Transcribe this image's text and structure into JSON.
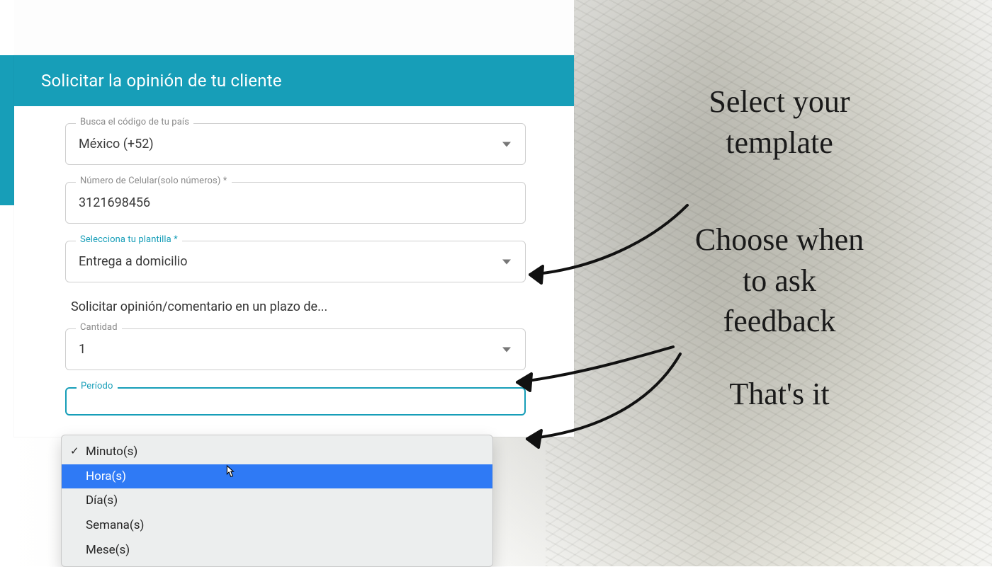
{
  "header": {
    "title": "Solicitar la opinión de tu cliente"
  },
  "fields": {
    "country": {
      "label": "Busca el código de tu país",
      "value": "México (+52)"
    },
    "phone": {
      "label": "Número de Celular(solo números) *",
      "value": "3121698456"
    },
    "template": {
      "label": "Selecciona tu plantilla *",
      "value": "Entrega a domicilio"
    },
    "schedule_section_label": "Solicitar opinión/comentario en un plazo de...",
    "quantity": {
      "label": "Cantidad",
      "value": "1"
    },
    "period": {
      "label": "Período",
      "options": [
        "Minuto(s)",
        "Hora(s)",
        "Día(s)",
        "Semana(s)",
        "Mese(s)"
      ],
      "selected_index": 0,
      "hovered_index": 1
    }
  },
  "annotations": {
    "line1a": "Select your",
    "line1b": "template",
    "line2a": "Choose when",
    "line2b": "to ask",
    "line2c": "feedback",
    "line3": "That's it"
  },
  "colors": {
    "teal": "#179eb8",
    "highlight": "#2f7af5"
  }
}
